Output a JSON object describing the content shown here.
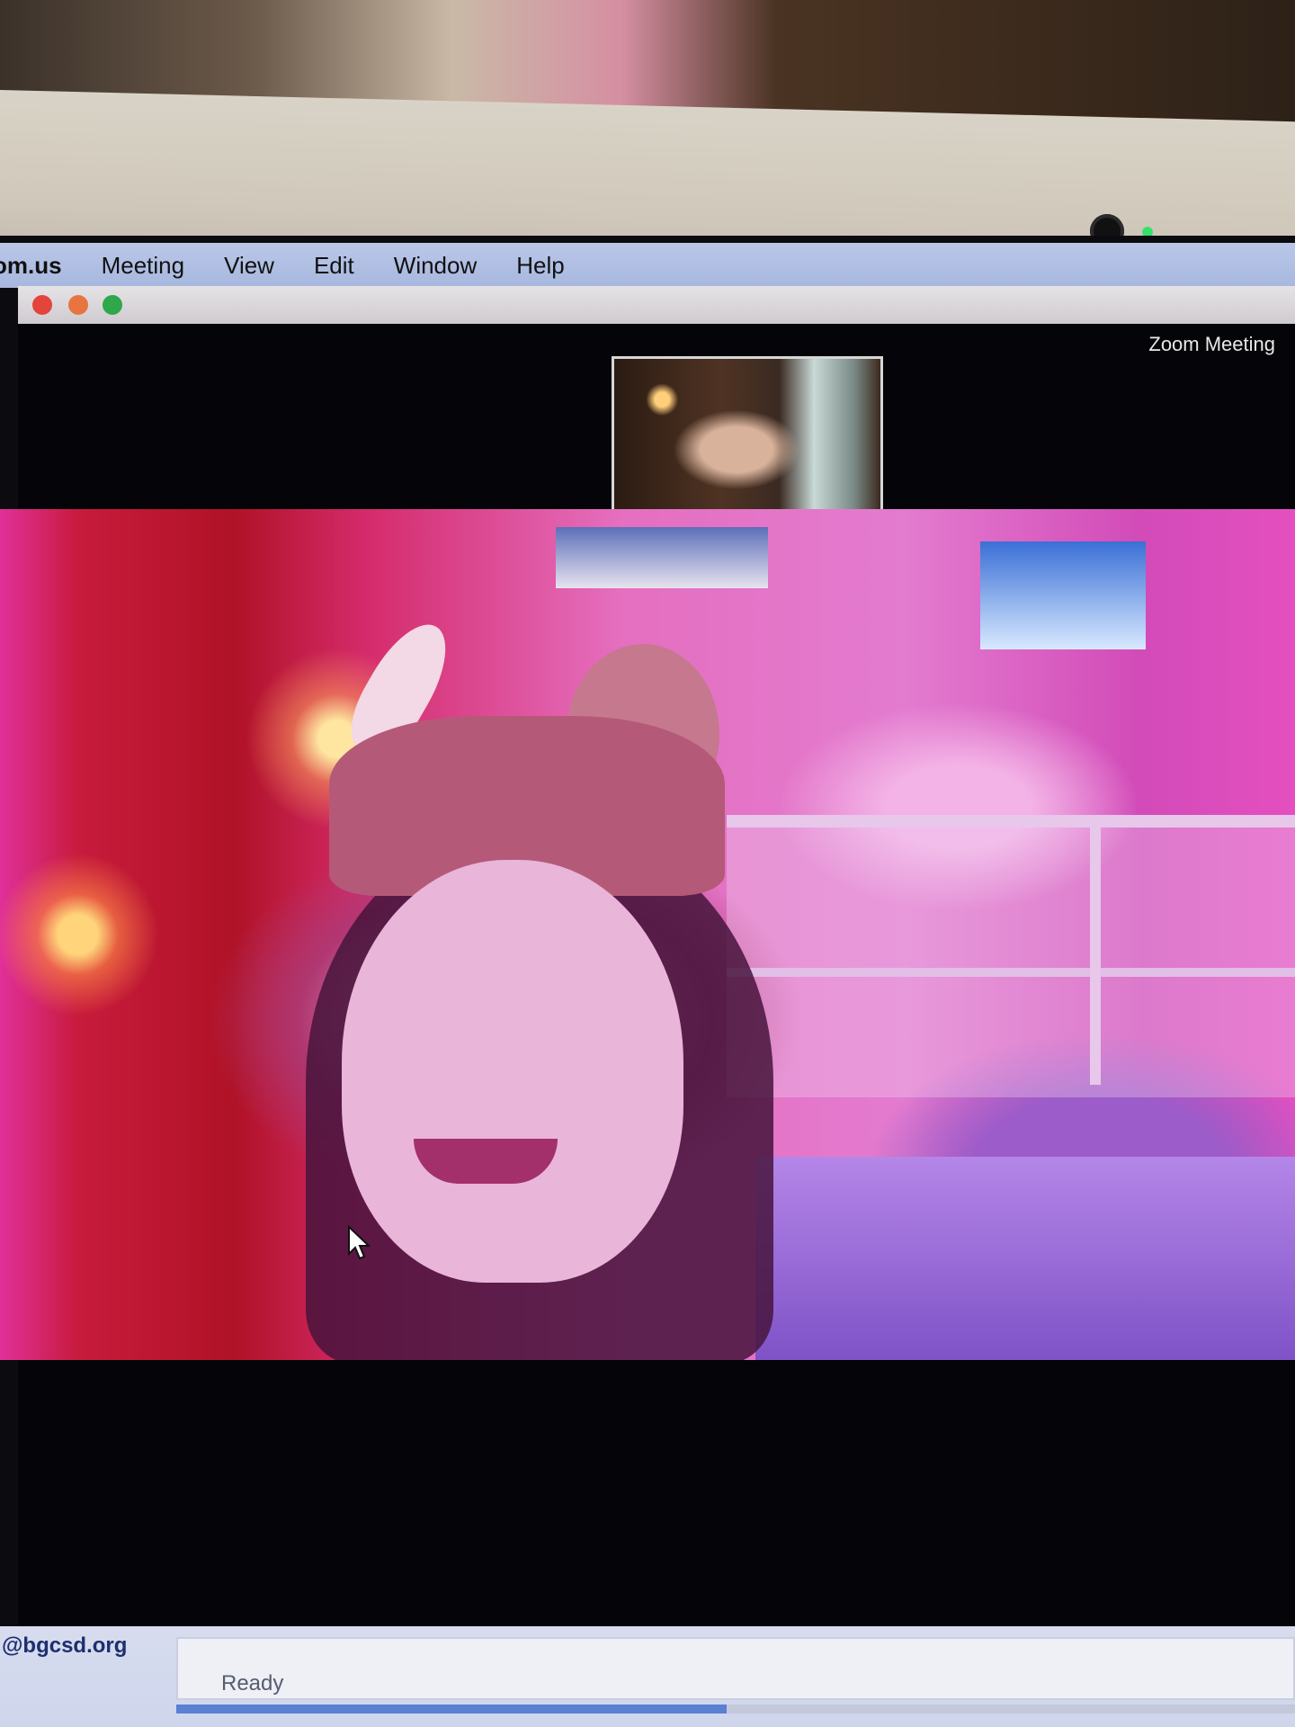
{
  "menubar": {
    "app_name": "om.us",
    "items": [
      "Meeting",
      "View",
      "Edit",
      "Window",
      "Help"
    ]
  },
  "window": {
    "title": "Zoom Meeting"
  },
  "mail_background": {
    "account_fragment": "@bgcsd.org",
    "status": "Ready"
  },
  "colors": {
    "menubar": "#a7b7de",
    "close_button": "#e3443b",
    "minimize_button": "#e8743f",
    "zoom_button": "#2ea84a"
  }
}
